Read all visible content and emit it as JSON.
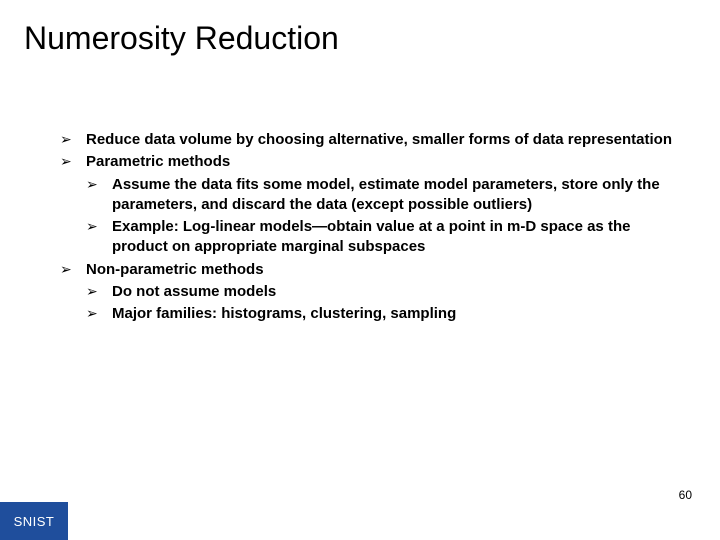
{
  "title": "Numerosity Reduction",
  "bullets": {
    "b1": "Reduce data volume by choosing alternative, smaller forms of data representation",
    "b2": "Parametric methods",
    "b2a": "Assume the data fits some model, estimate model parameters, store only the parameters, and discard the data (except possible outliers)",
    "b2b": "Example: Log-linear models—obtain value at a point in m-D space as the product on appropriate marginal subspaces",
    "b3": "Non-parametric methods",
    "b3a": "Do not assume models",
    "b3b": "Major families: histograms, clustering, sampling"
  },
  "footer": "SNIST",
  "page": "60"
}
